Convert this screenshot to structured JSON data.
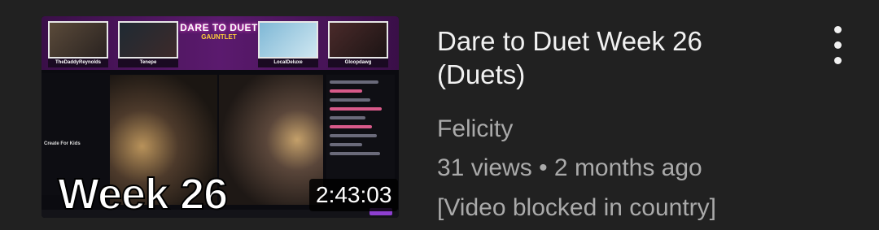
{
  "video": {
    "title": "Dare to Duet Week 26 (Duets)",
    "channel": "Felicity",
    "views": "31 views",
    "separator": "•",
    "age": "2 months ago",
    "status": "[Video blocked in country]",
    "duration": "2:43:03"
  },
  "thumbnail": {
    "overlay_text": "Week 26",
    "header_line1": "DARE TO DUET",
    "header_line2": "GAUNTLET",
    "cams": [
      "TheDaddyReynolds",
      "Tenepe",
      "LocalDeluxe",
      "Gloopdawg"
    ],
    "side_label": "Create For Kids"
  },
  "menu": {
    "icon": "more-vert-icon"
  }
}
